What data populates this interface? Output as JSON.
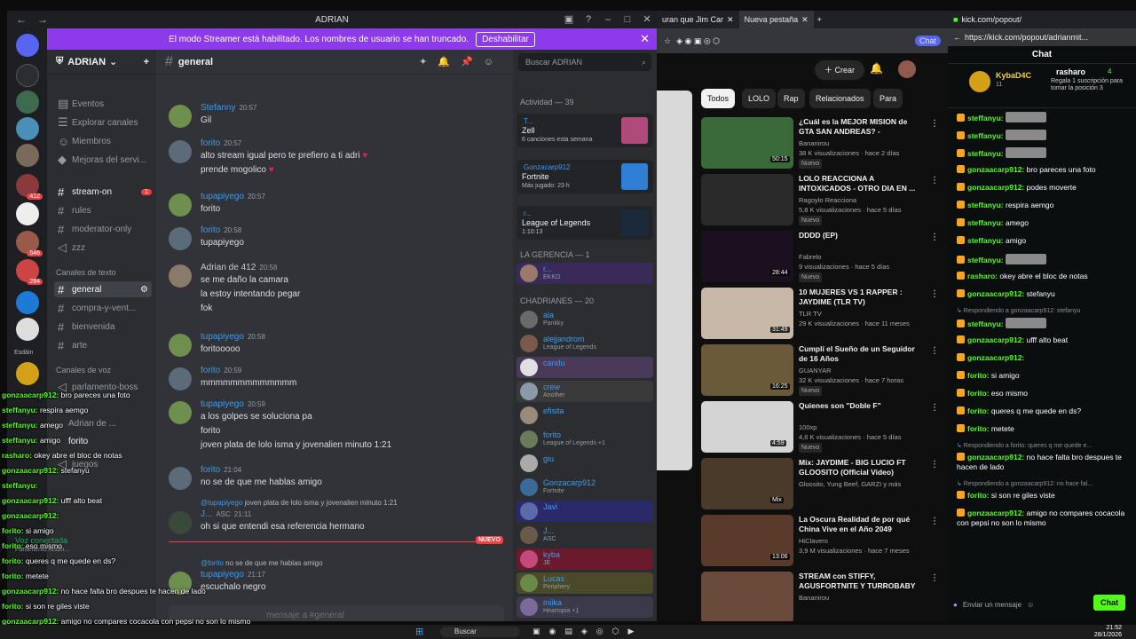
{
  "discord": {
    "window_title": "ADRIAN",
    "streamer_notice": "El modo Streamer está habilitado. Los nombres de usuario se han truncado.",
    "streamer_disable": "Deshabilitar",
    "server_name": "ADRIAN",
    "server_label": "Esdáin",
    "top_links": [
      "Eventos",
      "Explorar canales",
      "Miembros",
      "Mejoras del servi..."
    ],
    "channels_top": [
      "stream-on",
      "rules",
      "moderator-only",
      "zzz"
    ],
    "stream_on_badge": "1",
    "text_category": "Canales de texto",
    "text_channels": [
      "general",
      "compra-y-vent...",
      "bienvenida",
      "arte"
    ],
    "voice_category": "Canales de voz",
    "voice_channels": [
      "parlamento-boss"
    ],
    "voice_users": [
      "Adrian de ...",
      "forito"
    ],
    "voice_other": "juegos",
    "voice_status": "Voz conectada",
    "voice_status_sub": "Parlamento Andin...",
    "current_channel": "general",
    "search_placeholder": "Buscar ADRIAN",
    "input_placeholder": "mensaje a #general",
    "new_label": "NUEVO",
    "messages": [
      {
        "author": "Stefanny",
        "time": "20:57",
        "lines": [
          "Gil"
        ]
      },
      {
        "author": "forito",
        "time": "20:57",
        "lines": [
          "alto stream igual pero te prefiero a ti adri ♥",
          "prende mogolico ♥"
        ]
      },
      {
        "author": "tupapiyego",
        "time": "20:57",
        "lines": [
          "forito"
        ]
      },
      {
        "author": "forito",
        "time": "20:58",
        "lines": [
          "tupapiyego"
        ]
      },
      {
        "author": "Adrian de 412",
        "time": "20:58",
        "lines": [
          "se me daño la camara",
          "la estoy intentando pegar",
          "fok"
        ]
      },
      {
        "author": "tupapiyego",
        "time": "20:58",
        "lines": [
          "foritooooo"
        ]
      },
      {
        "author": "forito",
        "time": "20:59",
        "lines": [
          "mmmmmmmmmmmmm"
        ]
      },
      {
        "author": "tupapiyego",
        "time": "20:59",
        "lines": [
          "a los golpes se soluciona pa",
          "forito",
          "joven plata de lolo isma y jovenalien minuto 1:21"
        ]
      },
      {
        "author": "forito",
        "time": "21:04",
        "lines": [
          "no se de que me hablas amigo"
        ]
      },
      {
        "author": "J...",
        "time": "21:11",
        "reply_to": "@tupapiyego",
        "reply_text": "joven plata de lolo isma y jovenalien minuto 1:21",
        "tag": "ASC",
        "lines": [
          "oh si que entendi esa referencia hermano"
        ]
      },
      {
        "author": "tupapiyego",
        "time": "21:17",
        "reply_to": "@forito",
        "reply_text": "no se de que me hablas amigo",
        "lines": [
          "escuchalo negro"
        ]
      }
    ],
    "activity_title": "Actividad — 39",
    "activity_cards": [
      {
        "who": "T...",
        "game": "Zell",
        "sub": "6 canciones esta semana"
      },
      {
        "who": "Gonzacarp912",
        "game": "Fortnite",
        "sub": "Más jugado: 23 h"
      },
      {
        "who": "r...",
        "game": "League of Legends",
        "sub": "1:10:13"
      }
    ],
    "group1_title": "LA GERENCIA — 1",
    "group1_members": [
      {
        "name": "r...",
        "status": "EKKO"
      }
    ],
    "group2_title": "CHADRIANES — 20",
    "group2_members": [
      {
        "name": "ala",
        "status": "Pankky"
      },
      {
        "name": "alejjandrom",
        "status": "League of Legends"
      },
      {
        "name": "candu",
        "status": ""
      },
      {
        "name": "crew",
        "status": "Another"
      },
      {
        "name": "efisita",
        "status": ""
      },
      {
        "name": "forito",
        "status": "League of Legends +1"
      },
      {
        "name": "giu",
        "status": ""
      },
      {
        "name": "Gonzacarp912",
        "status": "Fortnite"
      },
      {
        "name": "Javi",
        "status": ""
      },
      {
        "name": "J...",
        "status": "ASC"
      },
      {
        "name": "kyba",
        "status": "JE"
      },
      {
        "name": "Lucas",
        "status": "Periphery"
      },
      {
        "name": "miika",
        "status": "Heartopia +1"
      }
    ]
  },
  "overlay_chat": [
    {
      "user": "gonzaacarp912:",
      "text": "bro pareces una foto"
    },
    {
      "user": "steffanyu:",
      "text": "respira aemgo"
    },
    {
      "user": "steffanyu:",
      "text": "amego"
    },
    {
      "user": "steffanyu:",
      "text": "amigo"
    },
    {
      "user": "rasharo:",
      "text": "okey abre el bloc de notas"
    },
    {
      "user": "gonzaacarp912:",
      "text": "stefanyu"
    },
    {
      "user": "steffanyu:",
      "text": ""
    },
    {
      "user": "gonzaacarp912:",
      "text": "ufff alto beat"
    },
    {
      "user": "gonzaacarp912:",
      "text": ""
    },
    {
      "user": "forito:",
      "text": "si amigo"
    },
    {
      "user": "forito:",
      "text": "eso mismo"
    },
    {
      "user": "forito:",
      "text": "queres q me quede en ds?"
    },
    {
      "user": "forito:",
      "text": "metete"
    },
    {
      "user": "gonzaacarp912:",
      "text": "no hace falta bro despues te hacen de lado"
    },
    {
      "user": "forito:",
      "text": "si son re giles viste"
    },
    {
      "user": "gonzaacarp912:",
      "text": "amigo no compares cocacola con pepsi no son lo mismo"
    }
  ],
  "youtube": {
    "tabs": [
      "uran que Jim Car",
      "Nueva pestaña"
    ],
    "create_label": "Crear",
    "chips": [
      "Todos",
      "LOLO",
      "Rap",
      "Relacionados",
      "Para"
    ],
    "videos": [
      {
        "title": "¿Cuál es la MEJOR MISION de GTA SAN ANDREAS? - TIERLIS...",
        "channel": "Bananirou",
        "meta": "38 K visualizaciones · hace 2 días",
        "nuevo": "Nuevo",
        "duration": "50:15"
      },
      {
        "title": "LOLO REACCIONA A INTOXICADOS - OTRO DIA EN ...",
        "channel": "Ragoylo Reacciona",
        "meta": "5,8 K visualizaciones · hace 5 días",
        "nuevo": "Nuevo",
        "duration": ""
      },
      {
        "title": "DDDD (EP)",
        "channel": "Fabrelo",
        "meta": "9 visualizaciones · hace 5 días",
        "nuevo": "Nuevo",
        "duration": "28:44"
      },
      {
        "title": "10 MUJERES VS 1 RAPPER : JAYDIME (TLR TV)",
        "channel": "TLR TV",
        "meta": "29 K visualizaciones · hace 11 meses",
        "nuevo": "",
        "duration": "31:49"
      },
      {
        "title": "Cumplí el Sueño de un Seguidor de 16 Años",
        "channel": "GUANYAR",
        "meta": "32 K visualizaciones · hace 7 horas",
        "nuevo": "Nuevo",
        "duration": "16:25"
      },
      {
        "title": "Quienes son \"Doble F\"",
        "channel": "100xp",
        "meta": "4,6 K visualizaciones · hace 5 días",
        "nuevo": "Nuevo",
        "duration": "4:59"
      },
      {
        "title": "Mix: JAYDIME - BIG LUCIO FT GLOOSITO (Official Video)",
        "channel": "Gloosito, Yung Beef, GARZI y más",
        "meta": "",
        "nuevo": "",
        "duration": "Mix"
      },
      {
        "title": "La Oscura Realidad de por qué China Vive en el Año 2049",
        "channel": "HiClavero",
        "meta": "3,9 M visualizaciones · hace 7 meses",
        "nuevo": "",
        "duration": "13:06"
      },
      {
        "title": "STREAM con STIFFY, AGUSFORTNITE Y TURROBABY",
        "channel": "Bananirou",
        "meta": "",
        "nuevo": "",
        "duration": ""
      }
    ]
  },
  "kick": {
    "url": "https://kick.com/popout/adrianmit...",
    "tab": "kick.com/popout/",
    "header": "Chat",
    "pinned_user": "KybaD4C",
    "pinned_count": "11",
    "pinned_top": "rasharo",
    "pinned_top_count": "4",
    "pinned_note": "Regala 1 suscripción para tomar la posición 3",
    "lines": [
      {
        "user": "steffanyu:",
        "text": "",
        "emote": true,
        "reply": ""
      },
      {
        "user": "steffanyu:",
        "text": "",
        "emote": true,
        "reply": ""
      },
      {
        "user": "steffanyu:",
        "text": "",
        "emote": true,
        "reply": ""
      },
      {
        "user": "gonzaacarp912:",
        "text": "bro pareces una foto",
        "emote": false,
        "reply": ""
      },
      {
        "user": "gonzaacarp912:",
        "text": "podes moverte",
        "emote": false,
        "reply": ""
      },
      {
        "user": "steffanyu:",
        "text": "respira aemgo",
        "emote": false,
        "reply": ""
      },
      {
        "user": "steffanyu:",
        "text": "amego",
        "emote": false,
        "reply": ""
      },
      {
        "user": "steffanyu:",
        "text": "amigo",
        "emote": false,
        "reply": ""
      },
      {
        "user": "steffanyu:",
        "text": "",
        "emote": true,
        "reply": ""
      },
      {
        "user": "rasharo:",
        "text": "okey abre el bloc de notas",
        "emote": false,
        "reply": ""
      },
      {
        "user": "gonzaacarp912:",
        "text": "stefanyu",
        "emote": false,
        "reply": ""
      },
      {
        "user": "steffanyu:",
        "text": "",
        "emote": true,
        "reply": "Respondiendo a gonzaacarp912: stefanyu"
      },
      {
        "user": "gonzaacarp912:",
        "text": "ufff alto beat",
        "emote": false,
        "reply": ""
      },
      {
        "user": "gonzaacarp912:",
        "text": "",
        "emote": false,
        "reply": ""
      },
      {
        "user": "forito:",
        "text": "si amigo",
        "emote": false,
        "reply": ""
      },
      {
        "user": "forito:",
        "text": "eso mismo",
        "emote": false,
        "reply": ""
      },
      {
        "user": "forito:",
        "text": "queres q me quede en ds?",
        "emote": false,
        "reply": ""
      },
      {
        "user": "forito:",
        "text": "metete",
        "emote": false,
        "reply": ""
      },
      {
        "user": "gonzaacarp912:",
        "text": "no hace falta bro despues te hacen de lado",
        "emote": false,
        "reply": "Respondiendo a forito: queres q me quede e..."
      },
      {
        "user": "forito:",
        "text": "si son re giles viste",
        "emote": false,
        "reply": "Respondiendo a gonzaacarp912: no hace fal..."
      },
      {
        "user": "gonzaacarp912:",
        "text": "amigo no compares cocacola con pepsi no son lo mismo",
        "emote": false,
        "reply": ""
      }
    ],
    "input_placeholder": "Enviar un mensaje",
    "chat_button": "Chat"
  },
  "taskbar": {
    "search": "Buscar",
    "time": "21:52",
    "date": "28/1/2026"
  }
}
